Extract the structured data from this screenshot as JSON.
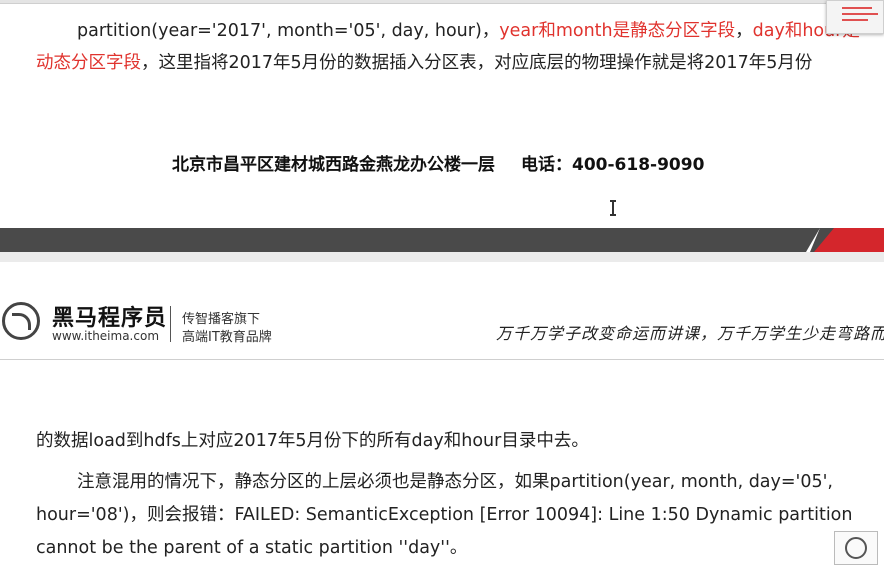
{
  "page1": {
    "line1": {
      "prefix": "partition(year='2017', month='05', day, hour)，",
      "red1": "year和month是静态分区字段",
      "sep": "，",
      "red2": "day和hour是"
    },
    "line2": {
      "red": "动态分区字段",
      "rest": "，这里指将2017年5月份的数据插入分区表，对应底层的物理操作就是将2017年5月份"
    },
    "footer": {
      "address": "北京市昌平区建材城西路金燕龙办公楼一层",
      "phone": "电话：400-618-9090"
    }
  },
  "header": {
    "brand_name": "黑马程序员",
    "brand_url": "www.itheima.com",
    "slogan_line1": "传智播客旗下",
    "slogan_line2": "高端IT教育品牌",
    "calligraphy": "万千万学子改变命运而讲课，万千万学生少走弯路而"
  },
  "page2": {
    "line1": "的数据load到hdfs上对应2017年5月份下的所有day和hour目录中去。",
    "line2": "注意混用的情况下，静态分区的上层必须也是静态分区，如果partition(year, month, day='05',",
    "line3": "hour='08')，则会报错：FAILED: SemanticException [Error 10094]: Line 1:50 Dynamic partition",
    "line4": "cannot be the parent of a static partition ''day''。"
  },
  "colors": {
    "accent_red": "#e0332e",
    "band_dark": "#4a4a4a",
    "band_red": "#d4262c"
  },
  "icons": [
    "text-cursor-icon",
    "horse-logo-icon",
    "corner-logo-icon"
  ]
}
